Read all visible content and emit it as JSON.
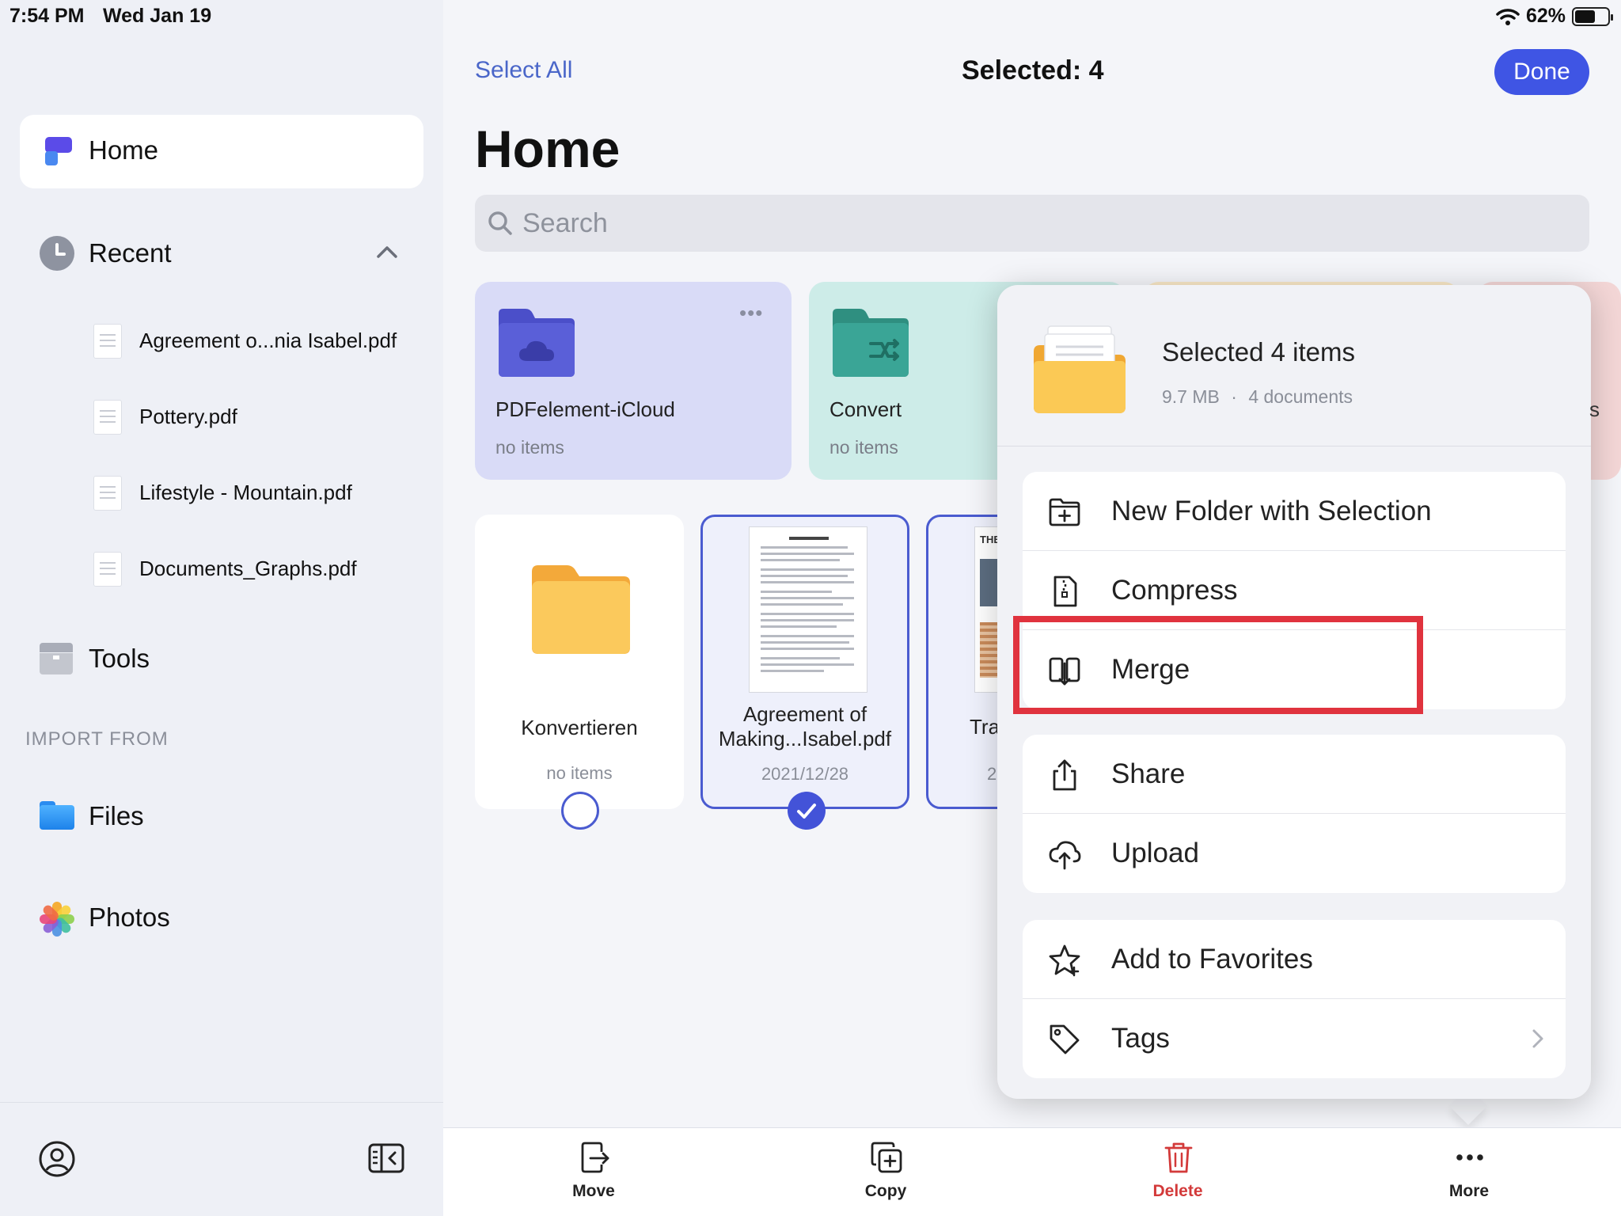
{
  "status_bar": {
    "time": "7:54 PM",
    "date": "Wed Jan 19",
    "battery": "62%",
    "battery_level": 0.62
  },
  "sidebar": {
    "home_label": "Home",
    "recent_label": "Recent",
    "recent_files": [
      "Agreement o...nia Isabel.pdf",
      "Pottery.pdf",
      "Lifestyle - Mountain.pdf",
      "Documents_Graphs.pdf"
    ],
    "tools_label": "Tools",
    "import_header": "IMPORT FROM",
    "files_label": "Files",
    "photos_label": "Photos"
  },
  "header": {
    "select_all": "Select All",
    "selected_count": "Selected: 4",
    "done": "Done"
  },
  "page_title": "Home",
  "search": {
    "placeholder": "Search"
  },
  "top_cards": [
    {
      "title": "PDFelement-iCloud",
      "subtitle": "no items"
    },
    {
      "title": "Convert",
      "subtitle": "no items"
    }
  ],
  "grid_items": [
    {
      "title": "Konvertieren",
      "subtitle": "no items",
      "selected": false
    },
    {
      "title_line1": "Agreement of",
      "title_line2": "Making...Isabel.pdf",
      "subtitle": "2021/12/28",
      "selected": true
    },
    {
      "title": "Tra",
      "subtitle": "2",
      "selected": true
    }
  ],
  "popover": {
    "title": "Selected 4 items",
    "size": "9.7 MB",
    "separator": "·",
    "doc_count": "4 documents",
    "peek_letter": "s",
    "actions_group1": [
      "New Folder with Selection",
      "Compress",
      "Merge"
    ],
    "actions_group2": [
      "Share",
      "Upload"
    ],
    "actions_group3": [
      "Add to Favorites",
      "Tags"
    ]
  },
  "toolbar": {
    "move": "Move",
    "copy": "Copy",
    "delete": "Delete",
    "more": "More"
  },
  "colors": {
    "accent": "#3f55e4",
    "delete_red": "#d33a3a",
    "highlight_red": "#e0333e"
  }
}
